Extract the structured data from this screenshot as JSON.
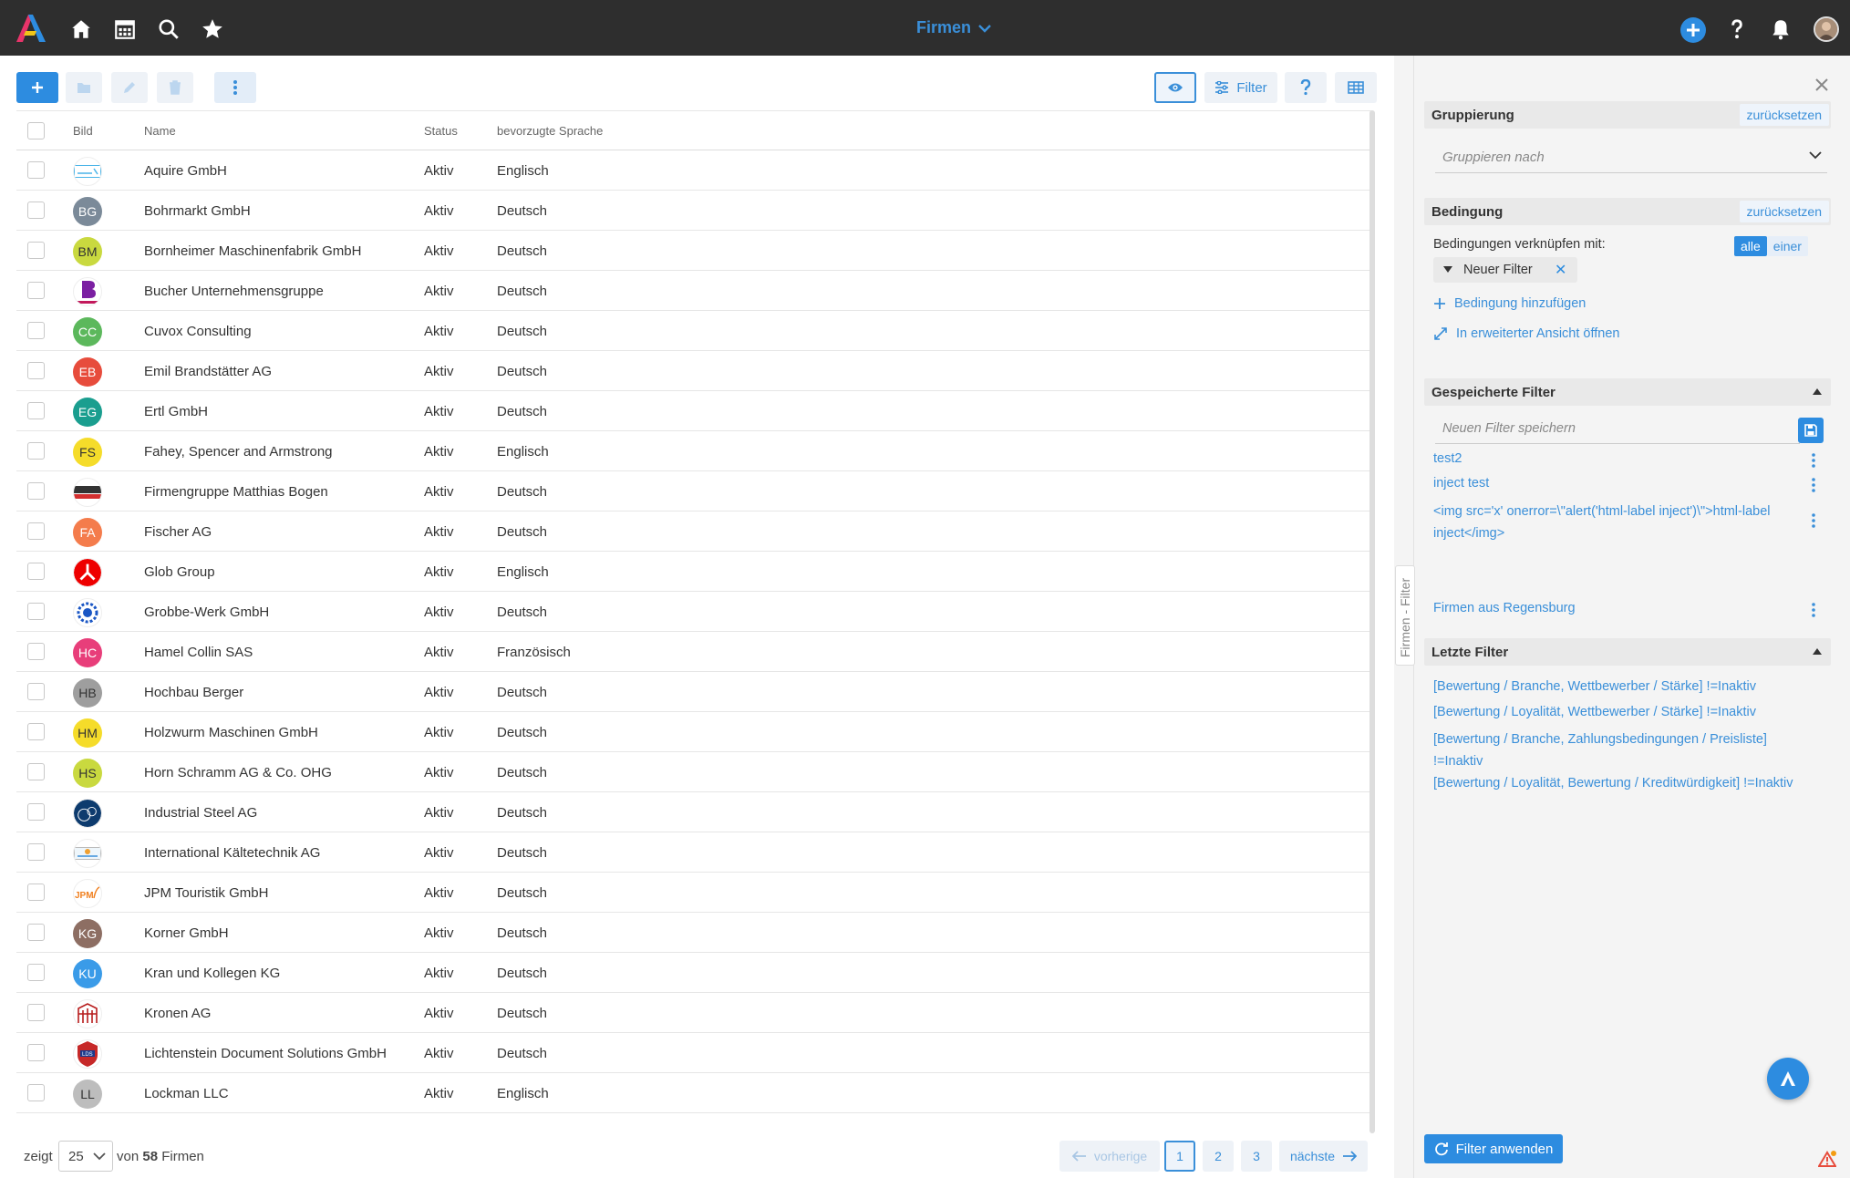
{
  "header": {
    "title": "Firmen"
  },
  "table": {
    "columns": [
      "Bild",
      "Name",
      "Status",
      "bevorzugte Sprache"
    ],
    "rows": [
      {
        "initials": "",
        "logo": "aquire",
        "name": "Aquire GmbH",
        "status": "Aktiv",
        "lang": "Englisch"
      },
      {
        "initials": "BG",
        "color": "#7b8a99",
        "name": "Bohrmarkt GmbH",
        "status": "Aktiv",
        "lang": "Deutsch"
      },
      {
        "initials": "BM",
        "color": "#c9d93f",
        "name": "Bornheimer Maschinenfabrik GmbH",
        "status": "Aktiv",
        "lang": "Deutsch"
      },
      {
        "initials": "",
        "logo": "bucher",
        "name": "Bucher Unternehmensgruppe",
        "status": "Aktiv",
        "lang": "Deutsch"
      },
      {
        "initials": "CC",
        "color": "#5cb85c",
        "name": "Cuvox Consulting",
        "status": "Aktiv",
        "lang": "Deutsch"
      },
      {
        "initials": "EB",
        "color": "#e74c3c",
        "name": "Emil Brandstätter AG",
        "status": "Aktiv",
        "lang": "Deutsch"
      },
      {
        "initials": "EG",
        "color": "#1a9e8f",
        "name": "Ertl GmbH",
        "status": "Aktiv",
        "lang": "Deutsch"
      },
      {
        "initials": "FS",
        "color": "#f5dc2a",
        "name": "Fahey, Spencer and Armstrong",
        "status": "Aktiv",
        "lang": "Englisch"
      },
      {
        "initials": "",
        "logo": "bogen",
        "name": "Firmengruppe Matthias Bogen",
        "status": "Aktiv",
        "lang": "Deutsch"
      },
      {
        "initials": "FA",
        "color": "#f47c4c",
        "name": "Fischer AG",
        "status": "Aktiv",
        "lang": "Deutsch"
      },
      {
        "initials": "",
        "logo": "glob",
        "name": "Glob Group",
        "status": "Aktiv",
        "lang": "Englisch"
      },
      {
        "initials": "",
        "logo": "grobbe",
        "name": "Grobbe-Werk GmbH",
        "status": "Aktiv",
        "lang": "Deutsch"
      },
      {
        "initials": "HC",
        "color": "#e83e7a",
        "name": "Hamel Collin SAS",
        "status": "Aktiv",
        "lang": "Französisch"
      },
      {
        "initials": "HB",
        "color": "#9e9e9e",
        "name": "Hochbau Berger",
        "status": "Aktiv",
        "lang": "Deutsch"
      },
      {
        "initials": "HM",
        "color": "#f5dc2a",
        "name": "Holzwurm Maschinen GmbH",
        "status": "Aktiv",
        "lang": "Deutsch"
      },
      {
        "initials": "HS",
        "color": "#c9d93f",
        "name": "Horn Schramm AG & Co. OHG",
        "status": "Aktiv",
        "lang": "Deutsch"
      },
      {
        "initials": "",
        "logo": "steel",
        "name": "Industrial Steel AG",
        "status": "Aktiv",
        "lang": "Deutsch"
      },
      {
        "initials": "",
        "logo": "kaelte",
        "name": "International Kältetechnik AG",
        "status": "Aktiv",
        "lang": "Deutsch"
      },
      {
        "initials": "",
        "logo": "jpm",
        "name": "JPM Touristik GmbH",
        "status": "Aktiv",
        "lang": "Deutsch"
      },
      {
        "initials": "KG",
        "color": "#8d6e63",
        "name": "Korner GmbH",
        "status": "Aktiv",
        "lang": "Deutsch"
      },
      {
        "initials": "KU",
        "color": "#3a9be8",
        "name": "Kran und Kollegen KG",
        "status": "Aktiv",
        "lang": "Deutsch"
      },
      {
        "initials": "",
        "logo": "kronen",
        "name": "Kronen AG",
        "status": "Aktiv",
        "lang": "Deutsch"
      },
      {
        "initials": "",
        "logo": "lds",
        "name": "Lichtenstein Document Solutions GmbH",
        "status": "Aktiv",
        "lang": "Deutsch"
      },
      {
        "initials": "LL",
        "color": "#bdbdbd",
        "name": "Lockman LLC",
        "status": "Aktiv",
        "lang": "Englisch"
      }
    ]
  },
  "toolbar": {
    "filter_label": "Filter"
  },
  "footer": {
    "shows_label": "zeigt",
    "page_size": "25",
    "of_label": "von",
    "total": "58",
    "entity_label": "Firmen",
    "prev_label": "vorherige",
    "next_label": "nächste",
    "pages": [
      "1",
      "2",
      "3"
    ]
  },
  "panel": {
    "vertical_tab": "Firmen - Filter",
    "grouping_title": "Gruppierung",
    "reset_label": "zurücksetzen",
    "group_by_placeholder": "Gruppieren nach",
    "condition_title": "Bedingung",
    "combine_label": "Bedingungen verknüpfen mit:",
    "combine_all": "alle",
    "combine_any": "einer",
    "new_filter_chip": "Neuer Filter",
    "add_condition": "Bedingung hinzufügen",
    "open_extended": "In erweiterter Ansicht öffnen",
    "saved_title": "Gespeicherte Filter",
    "save_placeholder": "Neuen Filter speichern",
    "saved_filters": [
      "test2",
      "inject test",
      "<img src='x' onerror=\\\"alert('html-label inject')\\\">html-label inject</img>",
      "Firmen aus Regensburg"
    ],
    "recent_title": "Letzte Filter",
    "recent_filters": [
      "[Bewertung / Branche, Wettbewerber / Stärke] !=Inaktiv",
      "[Bewertung / Loyalität, Wettbewerber / Stärke] !=Inaktiv",
      "[Bewertung / Branche, Zahlungsbedingungen / Preisliste] !=Inaktiv",
      "[Bewertung / Loyalität, Bewertung / Kreditwürdigkeit] !=Inaktiv"
    ],
    "apply_label": "Filter anwenden"
  },
  "colors": {
    "accent": "#2d8ce0",
    "topbar": "#2e2e2e",
    "link": "#3a8fd9"
  }
}
